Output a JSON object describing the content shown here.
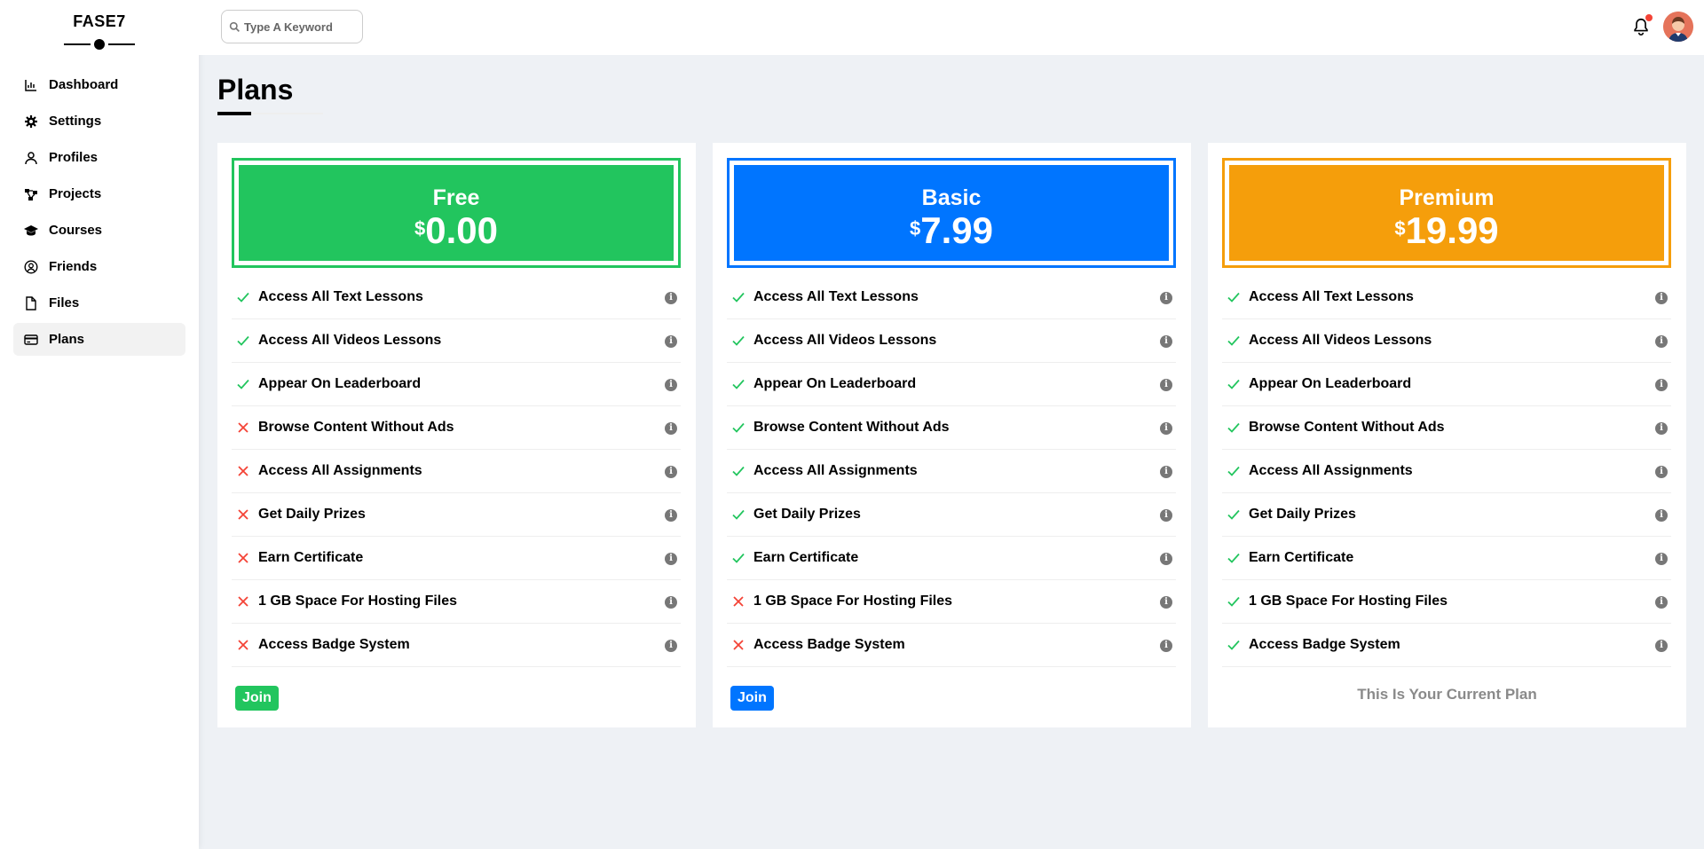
{
  "app": {
    "logo": "FASE7"
  },
  "sidebar": {
    "items": [
      {
        "label": "Dashboard",
        "icon": "chart-icon",
        "active": false
      },
      {
        "label": "Settings",
        "icon": "gear-icon",
        "active": false
      },
      {
        "label": "Profiles",
        "icon": "user-icon",
        "active": false
      },
      {
        "label": "Projects",
        "icon": "diagram-icon",
        "active": false
      },
      {
        "label": "Courses",
        "icon": "graduation-cap-icon",
        "active": false
      },
      {
        "label": "Friends",
        "icon": "user-circle-icon",
        "active": false
      },
      {
        "label": "Files",
        "icon": "file-icon",
        "active": false
      },
      {
        "label": "Plans",
        "icon": "credit-card-icon",
        "active": true
      }
    ]
  },
  "header": {
    "search_placeholder": "Type A Keyword",
    "has_notification": true
  },
  "page": {
    "title": "Plans"
  },
  "colors": {
    "free": "#22c55e",
    "basic": "#0075ff",
    "premium": "#f59e0b",
    "check": "#22c55e",
    "cross": "#f44336"
  },
  "plans": [
    {
      "name": "Free",
      "currency": "$",
      "price": "0.00",
      "color": "#22c55e",
      "features": [
        {
          "label": "Access All Text Lessons",
          "included": true
        },
        {
          "label": "Access All Videos Lessons",
          "included": true
        },
        {
          "label": "Appear On Leaderboard",
          "included": true
        },
        {
          "label": "Browse Content Without Ads",
          "included": false
        },
        {
          "label": "Access All Assignments",
          "included": false
        },
        {
          "label": "Get Daily Prizes",
          "included": false
        },
        {
          "label": "Earn Certificate",
          "included": false
        },
        {
          "label": "1 GB Space For Hosting Files",
          "included": false
        },
        {
          "label": "Access Badge System",
          "included": false
        }
      ],
      "action_label": "Join"
    },
    {
      "name": "Basic",
      "currency": "$",
      "price": "7.99",
      "color": "#0075ff",
      "features": [
        {
          "label": "Access All Text Lessons",
          "included": true
        },
        {
          "label": "Access All Videos Lessons",
          "included": true
        },
        {
          "label": "Appear On Leaderboard",
          "included": true
        },
        {
          "label": "Browse Content Without Ads",
          "included": true
        },
        {
          "label": "Access All Assignments",
          "included": true
        },
        {
          "label": "Get Daily Prizes",
          "included": true
        },
        {
          "label": "Earn Certificate",
          "included": true
        },
        {
          "label": "1 GB Space For Hosting Files",
          "included": false
        },
        {
          "label": "Access Badge System",
          "included": false
        }
      ],
      "action_label": "Join"
    },
    {
      "name": "Premium",
      "currency": "$",
      "price": "19.99",
      "color": "#f59e0b",
      "features": [
        {
          "label": "Access All Text Lessons",
          "included": true
        },
        {
          "label": "Access All Videos Lessons",
          "included": true
        },
        {
          "label": "Appear On Leaderboard",
          "included": true
        },
        {
          "label": "Browse Content Without Ads",
          "included": true
        },
        {
          "label": "Access All Assignments",
          "included": true
        },
        {
          "label": "Get Daily Prizes",
          "included": true
        },
        {
          "label": "Earn Certificate",
          "included": true
        },
        {
          "label": "1 GB Space For Hosting Files",
          "included": true
        },
        {
          "label": "Access Badge System",
          "included": true
        }
      ],
      "current_label": "This Is Your Current Plan"
    }
  ]
}
